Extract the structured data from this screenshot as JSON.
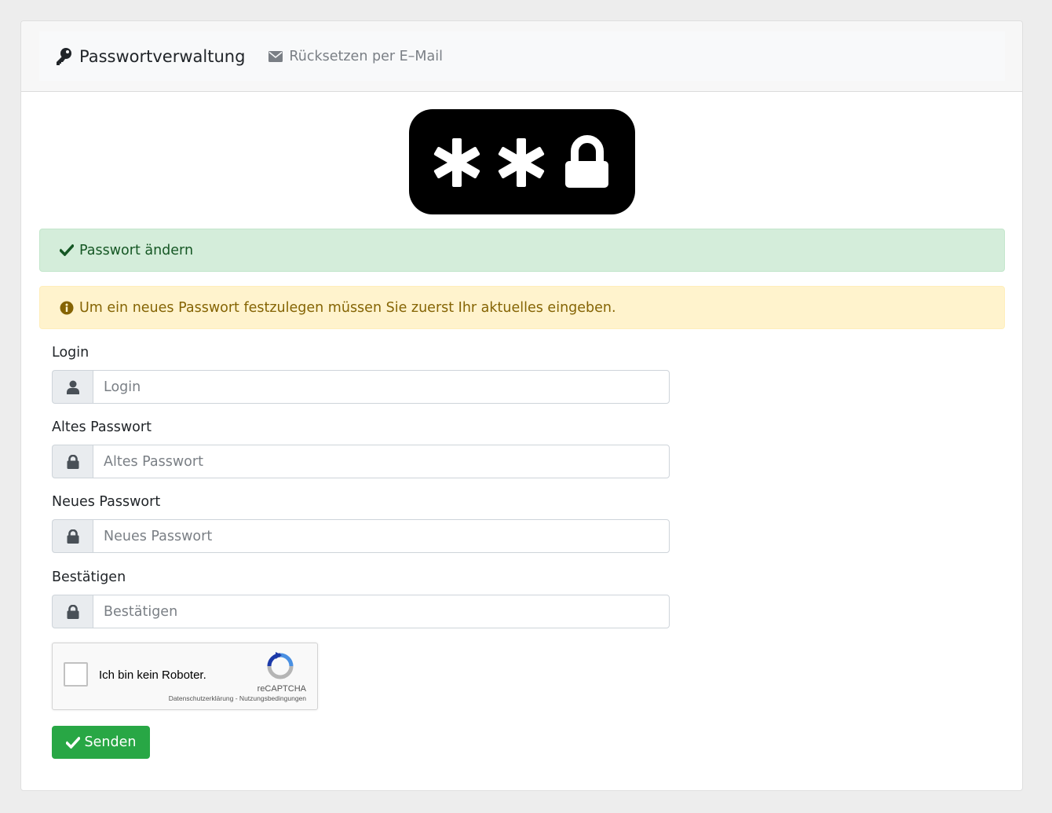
{
  "navbar": {
    "brand": "Passwortverwaltung",
    "brand_icon": "key-icon",
    "reset_link": "Rücksetzen per E–Mail",
    "reset_icon": "envelope-icon"
  },
  "logo": {
    "symbols": "**",
    "icon": "lock-icon"
  },
  "alerts": {
    "success": "Passwort ändern",
    "warning": "Um ein neues Passwort festzulegen müssen Sie zuerst Ihr aktuelles eingeben."
  },
  "form": {
    "login": {
      "label": "Login",
      "placeholder": "Login",
      "icon": "user-icon"
    },
    "old_password": {
      "label": "Altes Passwort",
      "placeholder": "Altes Passwort",
      "icon": "lock-icon"
    },
    "new_password": {
      "label": "Neues Passwort",
      "placeholder": "Neues Passwort",
      "icon": "lock-icon"
    },
    "confirm": {
      "label": "Bestätigen",
      "placeholder": "Bestätigen",
      "icon": "lock-icon"
    }
  },
  "recaptcha": {
    "label": "Ich bin kein Roboter.",
    "brand": "reCAPTCHA",
    "links": "Datenschutzerklärung - Nutzungsbedingungen"
  },
  "submit": {
    "label": "Senden",
    "icon": "check-icon"
  },
  "colors": {
    "success_bg": "#d4edda",
    "warning_bg": "#fff3cd",
    "button": "#28a745",
    "text_muted": "#7a7f85"
  }
}
